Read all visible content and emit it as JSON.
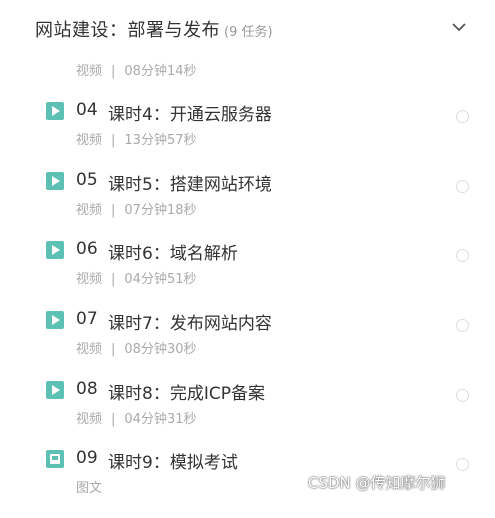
{
  "header": {
    "title": "网站建设：部署与发布",
    "count": "(9 任务)",
    "toggle_icon": "chevron-down-icon"
  },
  "partial_item": {
    "type": "视频",
    "sep": "|",
    "duration": "08分钟14秒"
  },
  "lessons": [
    {
      "num": "04",
      "title": "课时4：开通云服务器",
      "type": "视频",
      "sep": "|",
      "duration": "13分钟57秒",
      "icon": "play-icon"
    },
    {
      "num": "05",
      "title": "课时5：搭建网站环境",
      "type": "视频",
      "sep": "|",
      "duration": "07分钟18秒",
      "icon": "play-icon"
    },
    {
      "num": "06",
      "title": "课时6：域名解析",
      "type": "视频",
      "sep": "|",
      "duration": "04分钟51秒",
      "icon": "play-icon"
    },
    {
      "num": "07",
      "title": "课时7：发布网站内容",
      "type": "视频",
      "sep": "|",
      "duration": "08分钟30秒",
      "icon": "play-icon"
    },
    {
      "num": "08",
      "title": "课时8：完成ICP备案",
      "type": "视频",
      "sep": "|",
      "duration": "04分钟31秒",
      "icon": "play-icon"
    },
    {
      "num": "09",
      "title": "课时9：模拟考试",
      "type": "图文",
      "sep": "",
      "duration": "",
      "icon": "document-icon"
    }
  ],
  "watermark": "CSDN @传知摩尔狮",
  "colors": {
    "accent": "#5dc0b4",
    "text": "#333333",
    "muted": "#aaaaaa"
  }
}
